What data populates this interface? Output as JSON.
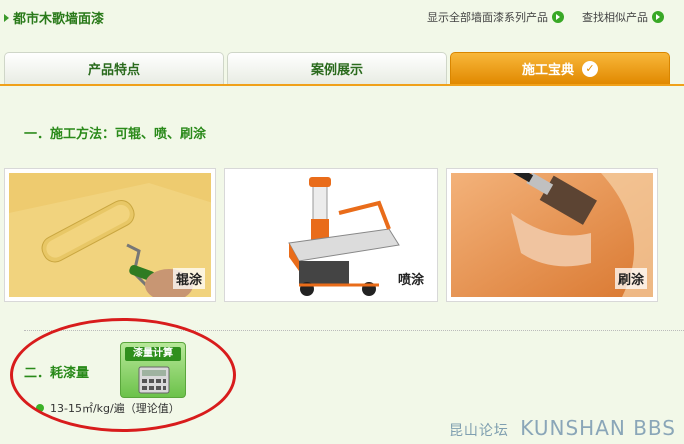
{
  "header": {
    "title": "都市木歌墙面漆",
    "link_all": "显示全部墙面漆系列产品",
    "link_similar": "查找相似产品"
  },
  "tabs": [
    {
      "label": "产品特点",
      "active": false
    },
    {
      "label": "案例展示",
      "active": false
    },
    {
      "label": "施工宝典",
      "active": true
    }
  ],
  "section1": {
    "title": "一．施工方法：可辊、喷、刷涂",
    "methods": [
      {
        "caption": "辊涂",
        "icon": "paint-roller-photo"
      },
      {
        "caption": "喷涂",
        "icon": "spray-machine-photo"
      },
      {
        "caption": "刷涂",
        "icon": "paint-brush-photo"
      }
    ]
  },
  "section2": {
    "title": "二．耗漆量",
    "calc_label": "漆量计算",
    "usage": "13-15㎡/kg/遍（理论值）"
  },
  "watermark": {
    "cn": "昆山论坛",
    "en": "KUNSHAN BBS"
  },
  "colors": {
    "accent_green": "#2a8a1a",
    "tab_active": "#f0a11a",
    "highlight_red": "#d81c1c"
  }
}
